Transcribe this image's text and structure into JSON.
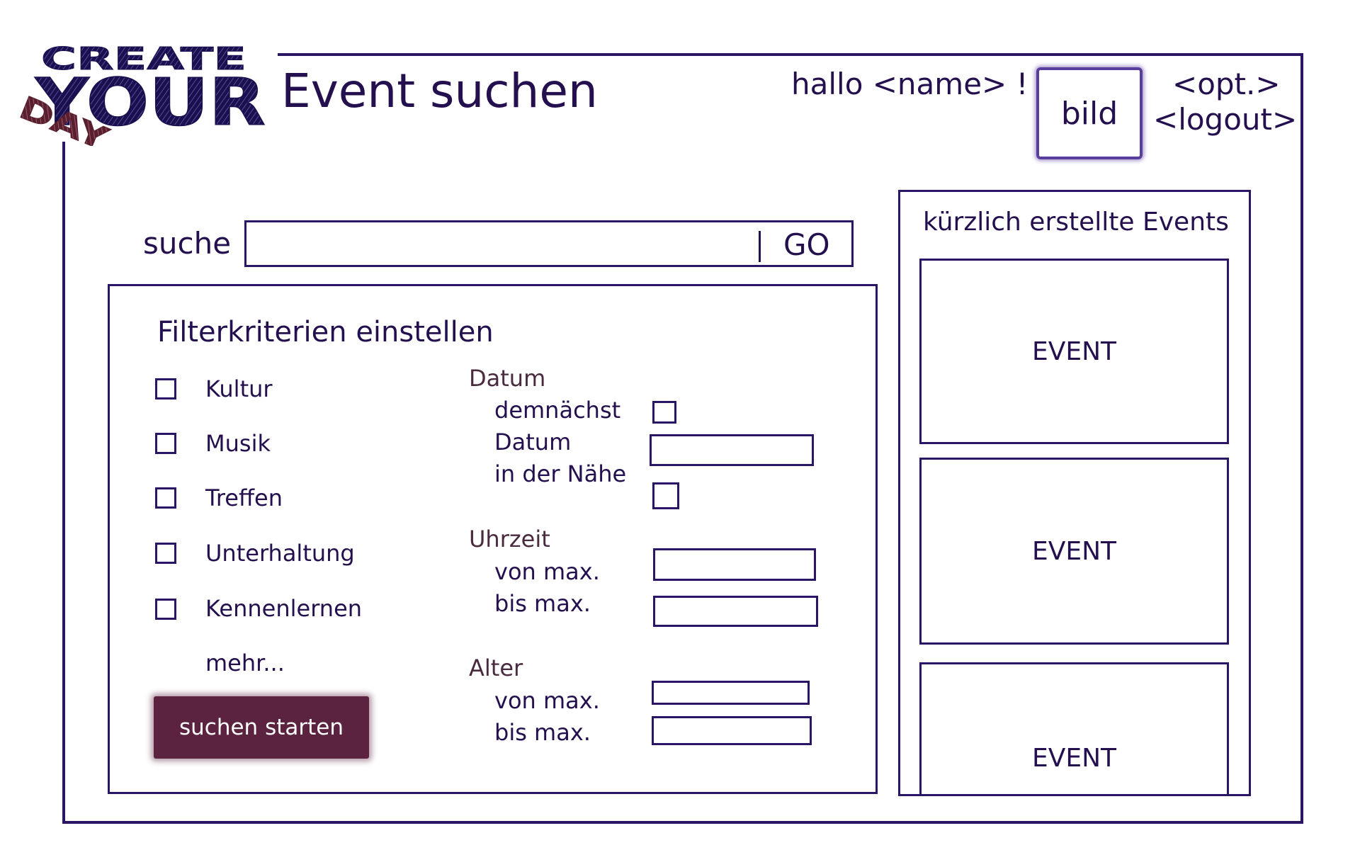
{
  "logo": {
    "line1": "CREATE",
    "line2": "YOUR",
    "line3": "DAY"
  },
  "header": {
    "title": "Event suchen",
    "greeting": "hallo <name> !",
    "profile_image_label": "bild",
    "options_link": "<opt.>",
    "logout_link": "<logout>"
  },
  "search": {
    "label": "suche",
    "value": "",
    "go_label": "GO"
  },
  "filter": {
    "title": "Filterkriterien einstellen",
    "categories": [
      "Kultur",
      "Musik",
      "Treffen",
      "Unterhaltung",
      "Kennenlernen"
    ],
    "more_link": "mehr...",
    "date": {
      "label": "Datum",
      "soon_label": "demnächst",
      "date_label": "Datum",
      "nearby_label": "in der Nähe"
    },
    "time": {
      "label": "Uhrzeit",
      "from_label": "von max.",
      "to_label": "bis max."
    },
    "age": {
      "label": "Alter",
      "from_label": "von max.",
      "to_label": "bis max."
    },
    "submit_label": "suchen starten"
  },
  "recent": {
    "title": "kürzlich erstellte Events",
    "events": [
      "EVENT",
      "EVENT",
      "EVENT"
    ]
  },
  "colors": {
    "primary": "#2b1565",
    "text": "#24104f",
    "section_label": "#4a2a3f",
    "submit_button": "#5c2340",
    "logo_accent": "#6b2436"
  }
}
